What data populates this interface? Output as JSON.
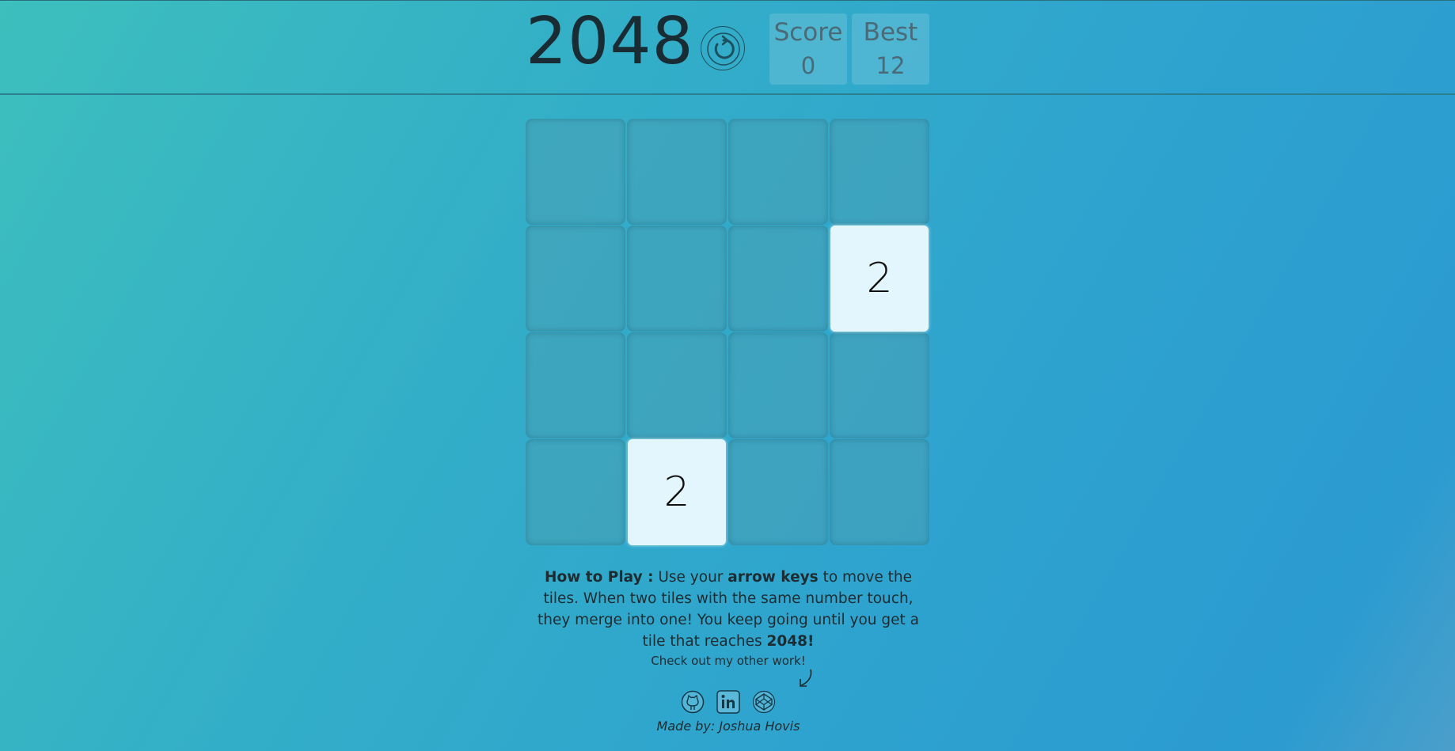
{
  "header": {
    "title": "2048",
    "restart_icon": "restart-icon",
    "score": {
      "label": "Score",
      "value": "0"
    },
    "best": {
      "label": "Best",
      "value": "12"
    }
  },
  "board": {
    "size": 4,
    "tiles": [
      {
        "row": 1,
        "col": 3,
        "value": "2"
      },
      {
        "row": 3,
        "col": 1,
        "value": "2"
      }
    ]
  },
  "instructions": {
    "heading": "How to Play :",
    "t1": " Use your ",
    "keys": "arrow keys",
    "t2": " to move the tiles. When two tiles with the same number touch, they merge into one! You keep going until you get a tile that reaches ",
    "goal": "2048!"
  },
  "footer": {
    "check_text": "Check out my other work!",
    "links": [
      {
        "icon": "github-icon"
      },
      {
        "icon": "linkedin-icon"
      },
      {
        "icon": "codepen-icon"
      }
    ],
    "made_by": "Made by: Joshua Hovis"
  },
  "colors": {
    "tile_bg": "#e3f6fd",
    "cell_bg": "#4aa3b5",
    "text": "#1a2c33"
  }
}
